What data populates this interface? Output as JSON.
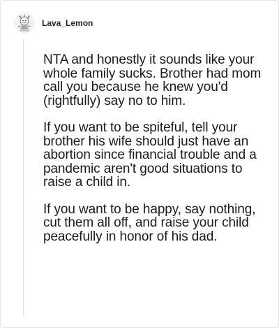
{
  "comment": {
    "username": "Lava_Lemon",
    "avatar_icon": "reddit-avatar-icon",
    "paragraphs": [
      "NTA and honestly it sounds like your whole family sucks. Brother had mom call you because he knew you'd (rightfully) say no to him.",
      "If you want to be spiteful, tell your brother his wife should just have an abortion since financial trouble and a pandemic aren't good situations to raise a child in.",
      "If you want to be happy, say nothing, cut them all off, and raise your child peacefully in honor of his dad."
    ]
  }
}
